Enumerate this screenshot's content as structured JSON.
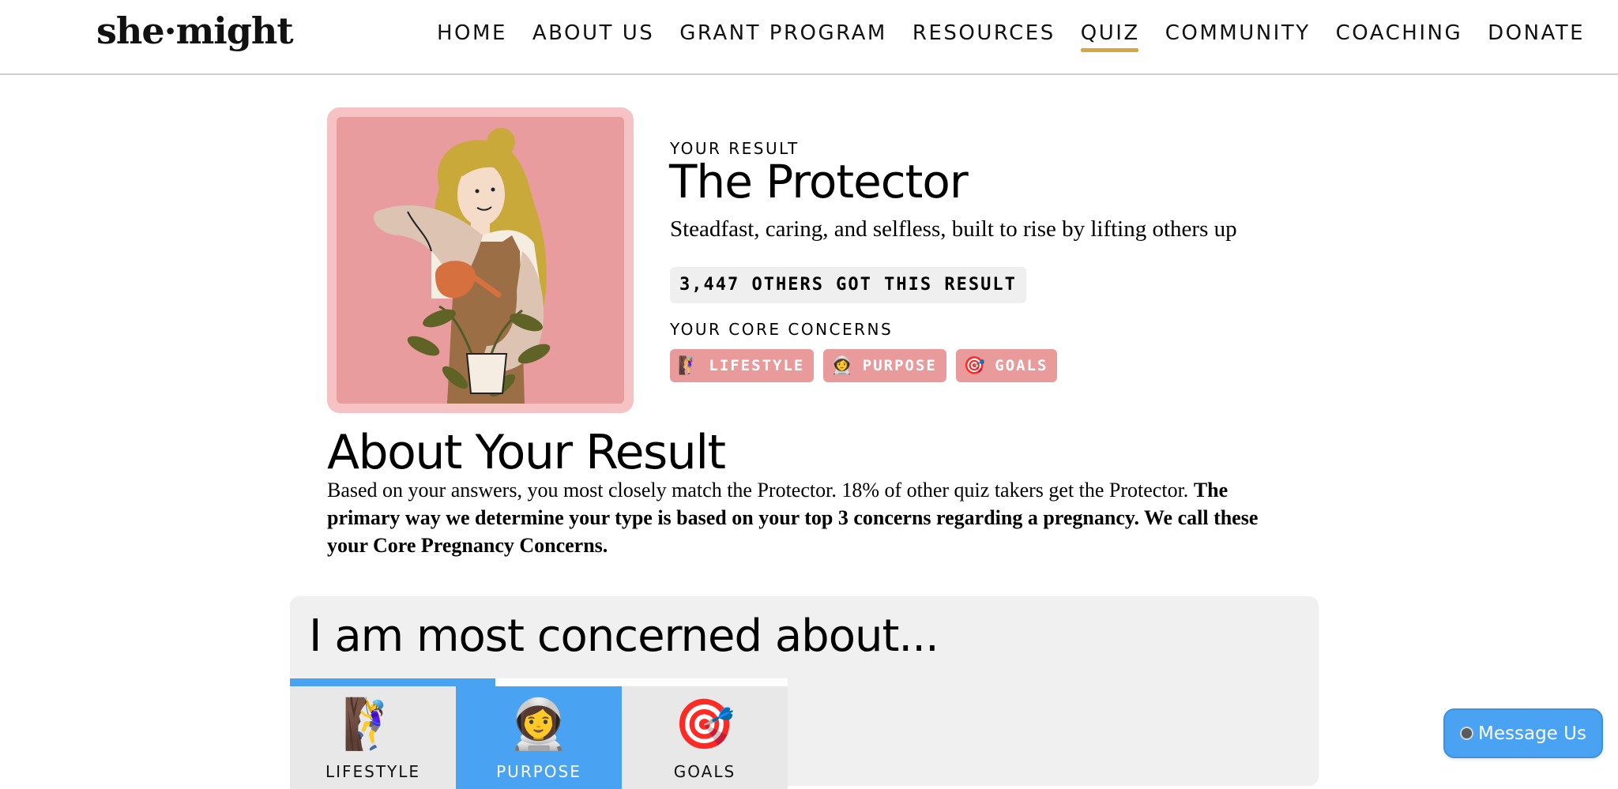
{
  "nav": {
    "logo": "she·might",
    "items": [
      {
        "label": "HOME"
      },
      {
        "label": "ABOUT US"
      },
      {
        "label": "GRANT PROGRAM"
      },
      {
        "label": "RESOURCES"
      },
      {
        "label": "QUIZ",
        "active": true
      },
      {
        "label": "COMMUNITY"
      },
      {
        "label": "COACHING"
      },
      {
        "label": "DONATE"
      }
    ],
    "accent_color": "#d4a841"
  },
  "result": {
    "label": "YOUR RESULT",
    "title": "The Protector",
    "subtitle": "Steadfast, caring, and selfless, built to rise by lifting others up",
    "count_text": "3,447 OTHERS GOT THIS RESULT",
    "core_label": "YOUR CORE CONCERNS",
    "chips": [
      {
        "emoji": "🧗‍♀️",
        "label": "LIFESTYLE",
        "icon": "climber-icon"
      },
      {
        "emoji": "👩‍🚀",
        "label": "PURPOSE",
        "icon": "astronaut-icon"
      },
      {
        "emoji": "🎯",
        "label": "GOALS",
        "icon": "target-icon"
      }
    ],
    "chip_color": "#e99a9b"
  },
  "about": {
    "heading": "About Your Result",
    "text_plain": "Based on your answers, you most closely match the Protector. 18% of other quiz takers get the Protector.",
    "text_bold": "The primary way we determine your type is based on your top 3 concerns regarding a pregnancy. We call these your Core Pregnancy Concerns."
  },
  "concerns": {
    "heading": "I am most concerned about...",
    "tabs": [
      {
        "emoji": "🧗‍♀️",
        "label": "LIFESTYLE",
        "progress": 1.0,
        "active": false
      },
      {
        "emoji": "👩‍🚀",
        "label": "PURPOSE",
        "progress": 0.24,
        "active": true
      },
      {
        "emoji": "🎯",
        "label": "GOALS",
        "progress": 0.0,
        "active": false
      }
    ],
    "accent_color": "#4aa3f2"
  },
  "message_button": {
    "label": "Message Us"
  }
}
